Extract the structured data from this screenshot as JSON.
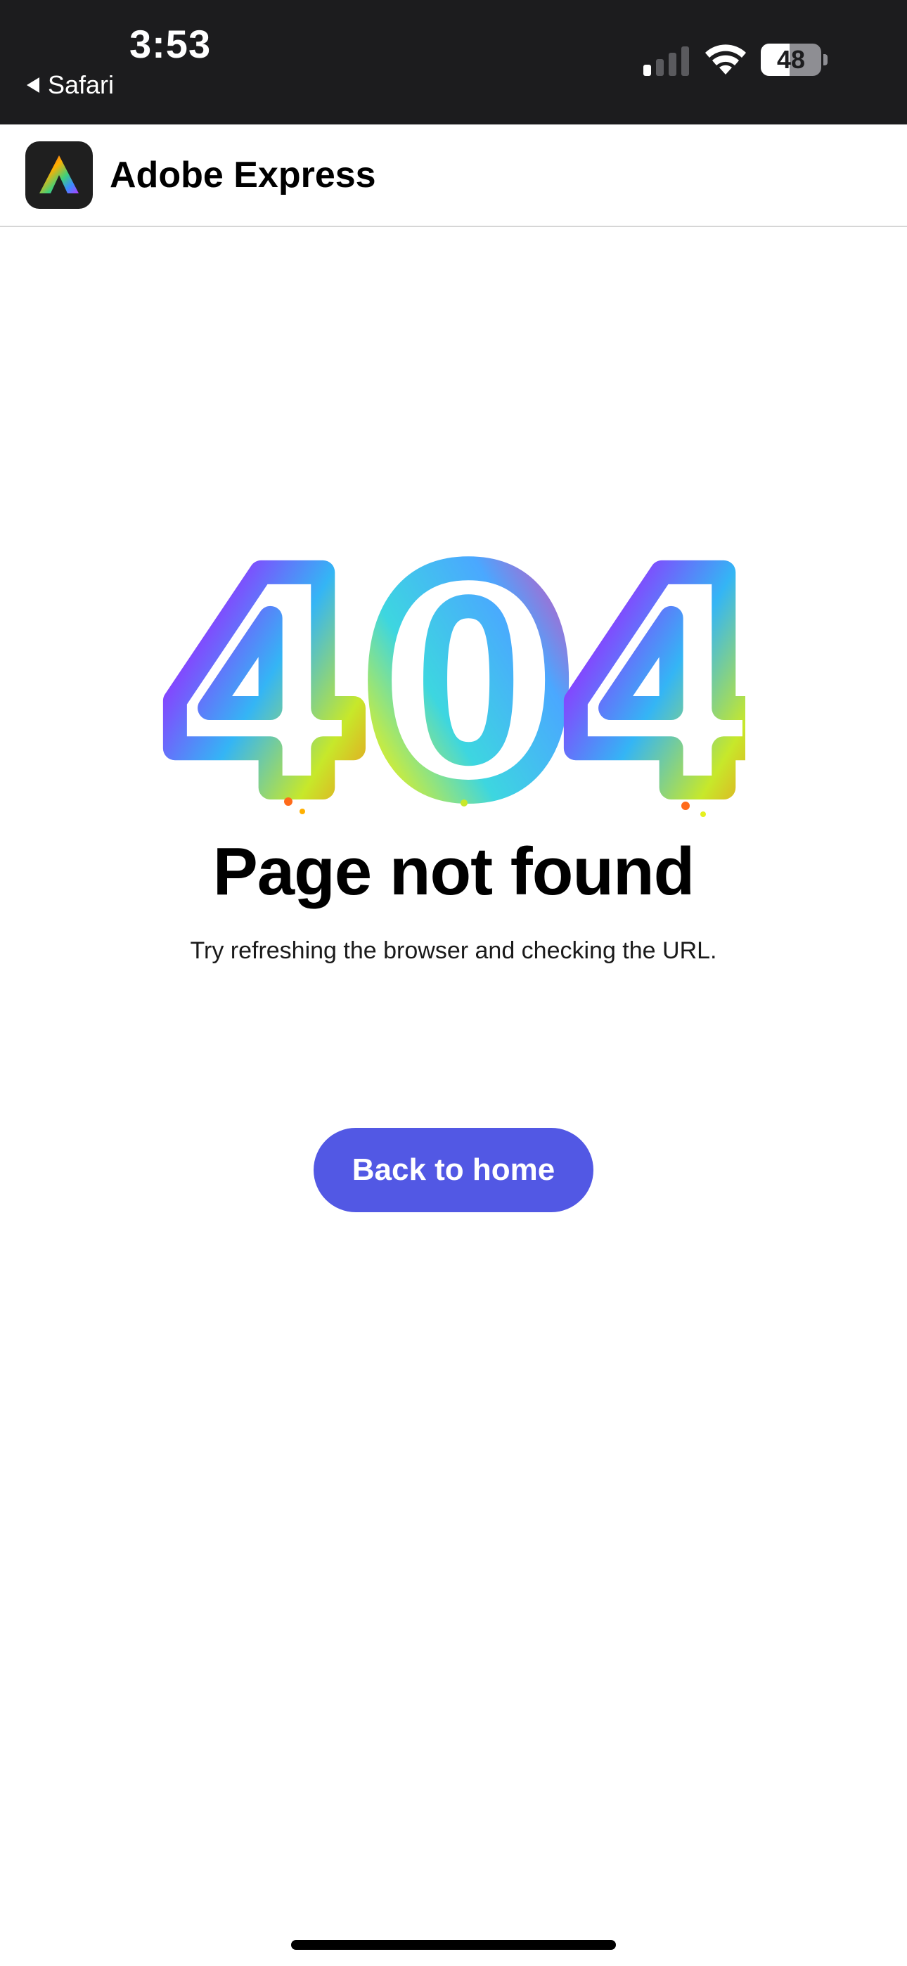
{
  "status_bar": {
    "time": "3:53",
    "back_app": "Safari",
    "battery_level": "48",
    "battery_fraction": 0.48,
    "signal_bars_active": 1,
    "signal_bars_total": 4
  },
  "header": {
    "app_name": "Adobe Express",
    "logo_icon": "adobe-express-logo"
  },
  "error": {
    "code": "404",
    "title": "Page not found",
    "message": "Try refreshing the browser and checking the URL."
  },
  "actions": {
    "back_home_label": "Back to home"
  },
  "colors": {
    "primary_button": "#5258e4",
    "status_bar_bg": "#1c1c1e"
  }
}
